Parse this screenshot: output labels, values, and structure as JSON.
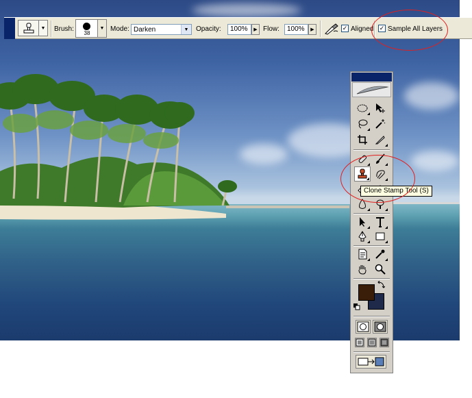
{
  "options_bar": {
    "brush_label": "Brush:",
    "brush_size": "38",
    "mode_label": "Mode:",
    "mode_value": "Darken",
    "opacity_label": "Opacity:",
    "opacity_value": "100%",
    "flow_label": "Flow:",
    "flow_value": "100%",
    "aligned_label": "Aligned",
    "aligned_checked": "✓",
    "sample_all_layers_label": "Sample All Layers",
    "sample_all_layers_checked": "✓"
  },
  "toolbox": {
    "tooltip": "Clone Stamp Tool (S)",
    "foreground_color": "#3b1e0a",
    "background_color": "#1f2a4a"
  },
  "annotation_color": "#e02020"
}
